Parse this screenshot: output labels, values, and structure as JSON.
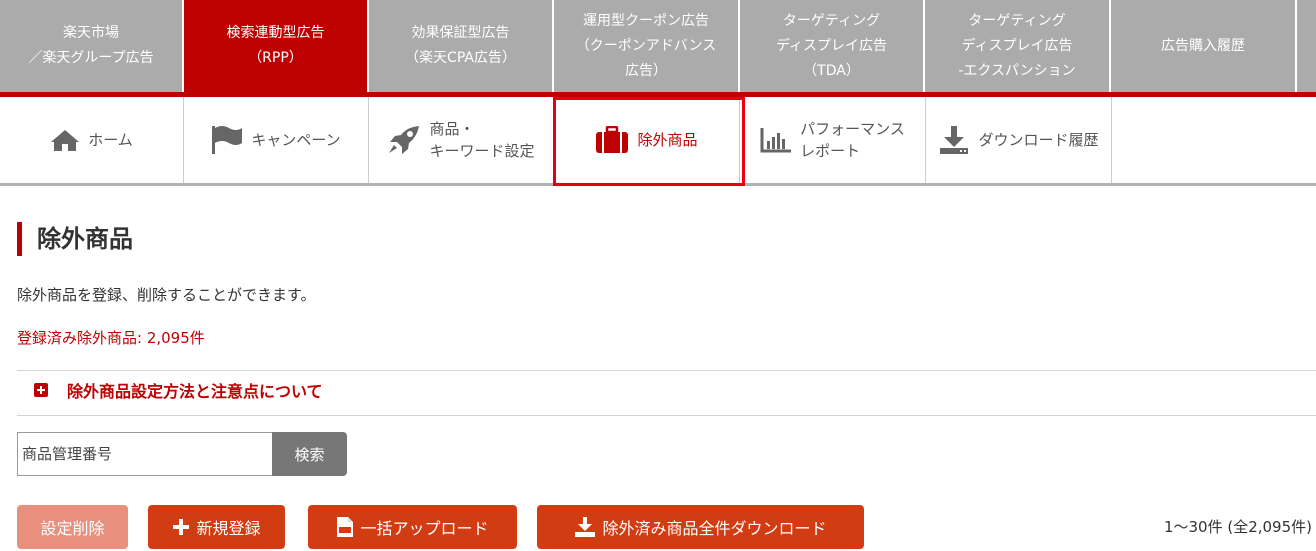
{
  "top_tabs": [
    {
      "label": "楽天市場\n／楽天グループ広告",
      "active": false
    },
    {
      "label": "検索連動型広告\n（RPP）",
      "active": true
    },
    {
      "label": "効果保証型広告\n（楽天CPA広告）",
      "active": false
    },
    {
      "label": "運用型クーポン広告\n（クーポンアドバンス\n広告）",
      "active": false
    },
    {
      "label": "ターゲティング\nディスプレイ広告\n（TDA）",
      "active": false
    },
    {
      "label": "ターゲティング\nディスプレイ広告\n-エクスパンション",
      "active": false
    },
    {
      "label": "広告購入履歴",
      "active": false
    }
  ],
  "sub_nav": [
    {
      "label": "ホーム",
      "icon": "home-icon"
    },
    {
      "label": "キャンペーン",
      "icon": "flag-icon"
    },
    {
      "label": "商品・\nキーワード設定",
      "icon": "rocket-icon"
    },
    {
      "label": "除外商品",
      "icon": "briefcase-icon",
      "active": true
    },
    {
      "label": "パフォーマンス\nレポート",
      "icon": "bar-chart-icon"
    },
    {
      "label": "ダウンロード履歴",
      "icon": "download-icon"
    }
  ],
  "main": {
    "title": "除外商品",
    "description": "除外商品を登録、削除することができます。",
    "registered": "登録済み除外商品: 2,095件",
    "notice": "除外商品設定方法と注意点について"
  },
  "search": {
    "placeholder": "商品管理番号",
    "button": "検索"
  },
  "buttons": {
    "delete": "設定削除",
    "new": "新規登録",
    "upload": "一括アップロード",
    "download": "除外済み商品全件ダウンロード"
  },
  "pagination": {
    "count": "1〜30件 (全2,095件)"
  },
  "colors": {
    "accent": "#bf0000",
    "button": "#d23c12",
    "button_disabled": "#e8907d",
    "tab_gray": "#ababab"
  }
}
